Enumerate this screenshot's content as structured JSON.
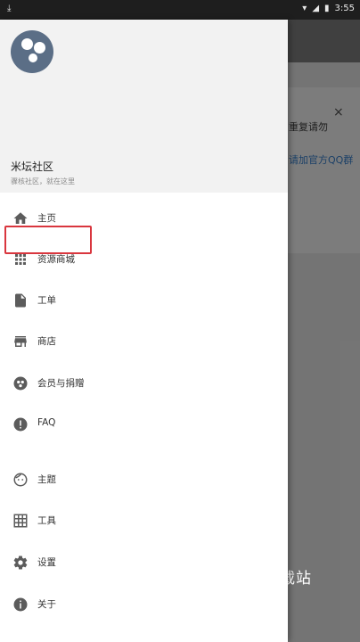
{
  "status_bar": {
    "left_icon": "download-icon",
    "time": "3:55",
    "icons": [
      "wifi-icon",
      "signal-icon",
      "battery-icon"
    ]
  },
  "background_app": {
    "notice_text": "重复请勿",
    "link_text": "请加官方QQ群",
    "close_symbol": "×"
  },
  "drawer": {
    "app_name": "米坛社区",
    "app_tagline": "骤核社区，就在这里",
    "menu": [
      {
        "label": "主页",
        "icon": "home-icon"
      },
      {
        "label": "资源商城",
        "icon": "grid-apps-icon",
        "highlighted": true
      },
      {
        "label": "工单",
        "icon": "document-icon"
      },
      {
        "label": "商店",
        "icon": "store-icon"
      },
      {
        "label": "会员与捐赠",
        "icon": "donate-icon"
      },
      {
        "label": "FAQ",
        "icon": "info-exclamation-icon"
      },
      {
        "label": "主题",
        "icon": "face-icon"
      },
      {
        "label": "工具",
        "icon": "table-grid-icon"
      },
      {
        "label": "设置",
        "icon": "gear-icon"
      },
      {
        "label": "关于",
        "icon": "info-icon"
      }
    ]
  },
  "watermark": "载站",
  "colors": {
    "accent": "#5b6e86",
    "highlight": "#d9363e"
  }
}
